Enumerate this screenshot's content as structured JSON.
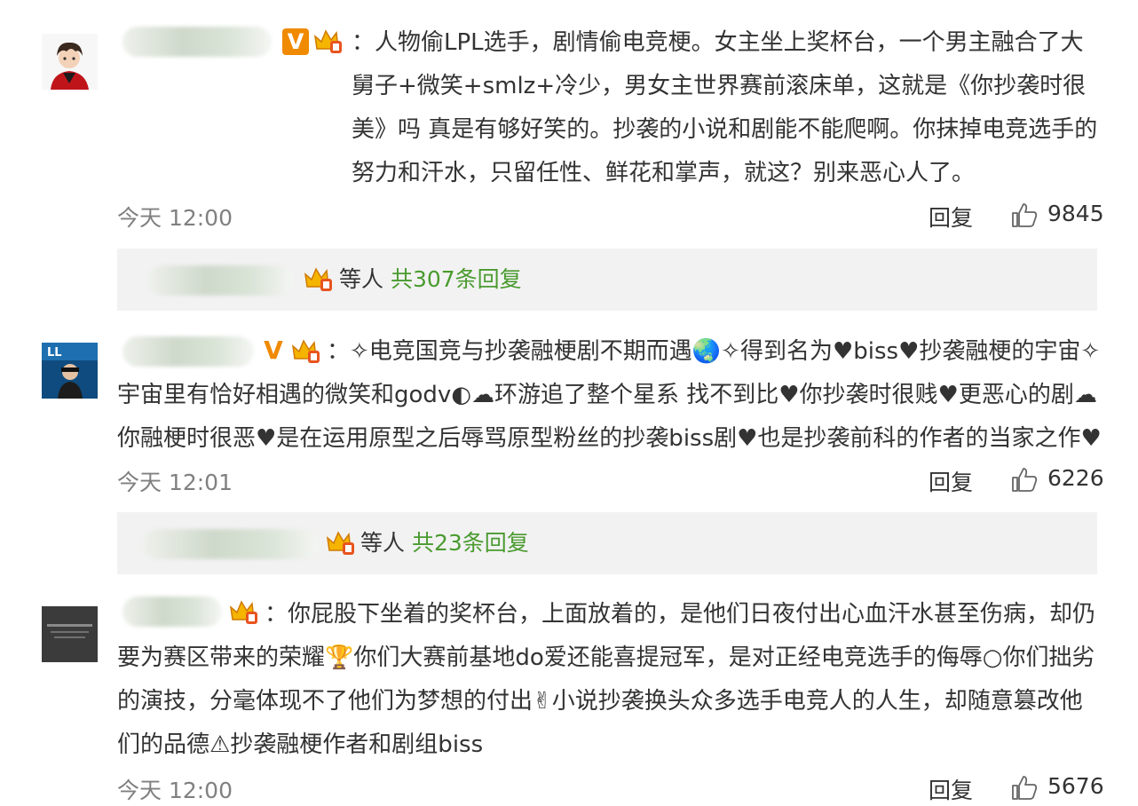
{
  "comments": [
    {
      "text": "：人物偷LPL选手，剧情偷电竞梗。女主坐上奖杯台，一个男主融合了大舅子+微笑+smlz+冷少，男女主世界赛前滚床单，这就是《你抄袭时很美》吗 真是有够好笑的。抄袭的小说和剧能不能爬啊。你抹掉电竞选手的努力和汗水，只留任性、鲜花和掌声，就这？别来恶心人了。",
      "time": "今天 12:00",
      "reply_label": "回复",
      "likes": "9845",
      "replies": {
        "who": "等人",
        "count_label": "共307条回复"
      }
    },
    {
      "text": "：✧电竞国竞与抄袭融梗剧不期而遇🌏✧得到名为♥biss♥抄袭融梗的宇宙✧宇宙里有恰好相遇的微笑和godv◐☁环游追了整个星系 找不到比♥你抄袭时很贱♥更恶心的剧☁你融梗时很恶♥是在运用原型之后辱骂原型粉丝的抄袭biss剧♥也是抄袭前科的作者的当家之作♥",
      "time": "今天 12:01",
      "reply_label": "回复",
      "likes": "6226",
      "replies": {
        "who": "等人",
        "count_label": "共23条回复"
      }
    },
    {
      "text": "：你屁股下坐着的奖杯台，上面放着的，是他们日夜付出心血汗水甚至伤病，却仍要为赛区带来的荣耀🏆你们大赛前基地do爱还能喜提冠军，是对正经电竞选手的侮辱○你们拙劣的演技，分毫体现不了他们为梦想的付出✌小说抄袭换头众多选手电竞人的人生，却随意篡改他们的品德⚠抄袭融梗作者和剧组biss",
      "time": "今天 12:00",
      "reply_label": "回复",
      "likes": "5676"
    }
  ],
  "icons": {
    "verified": "verified-v-icon",
    "crown": "crown-badge-icon",
    "like": "thumbs-up-icon"
  },
  "colors": {
    "accent_orange": "#f08a00",
    "link_green": "#4a9b2f",
    "muted_gray": "#808080",
    "reply_bg": "#f2f2f2"
  }
}
